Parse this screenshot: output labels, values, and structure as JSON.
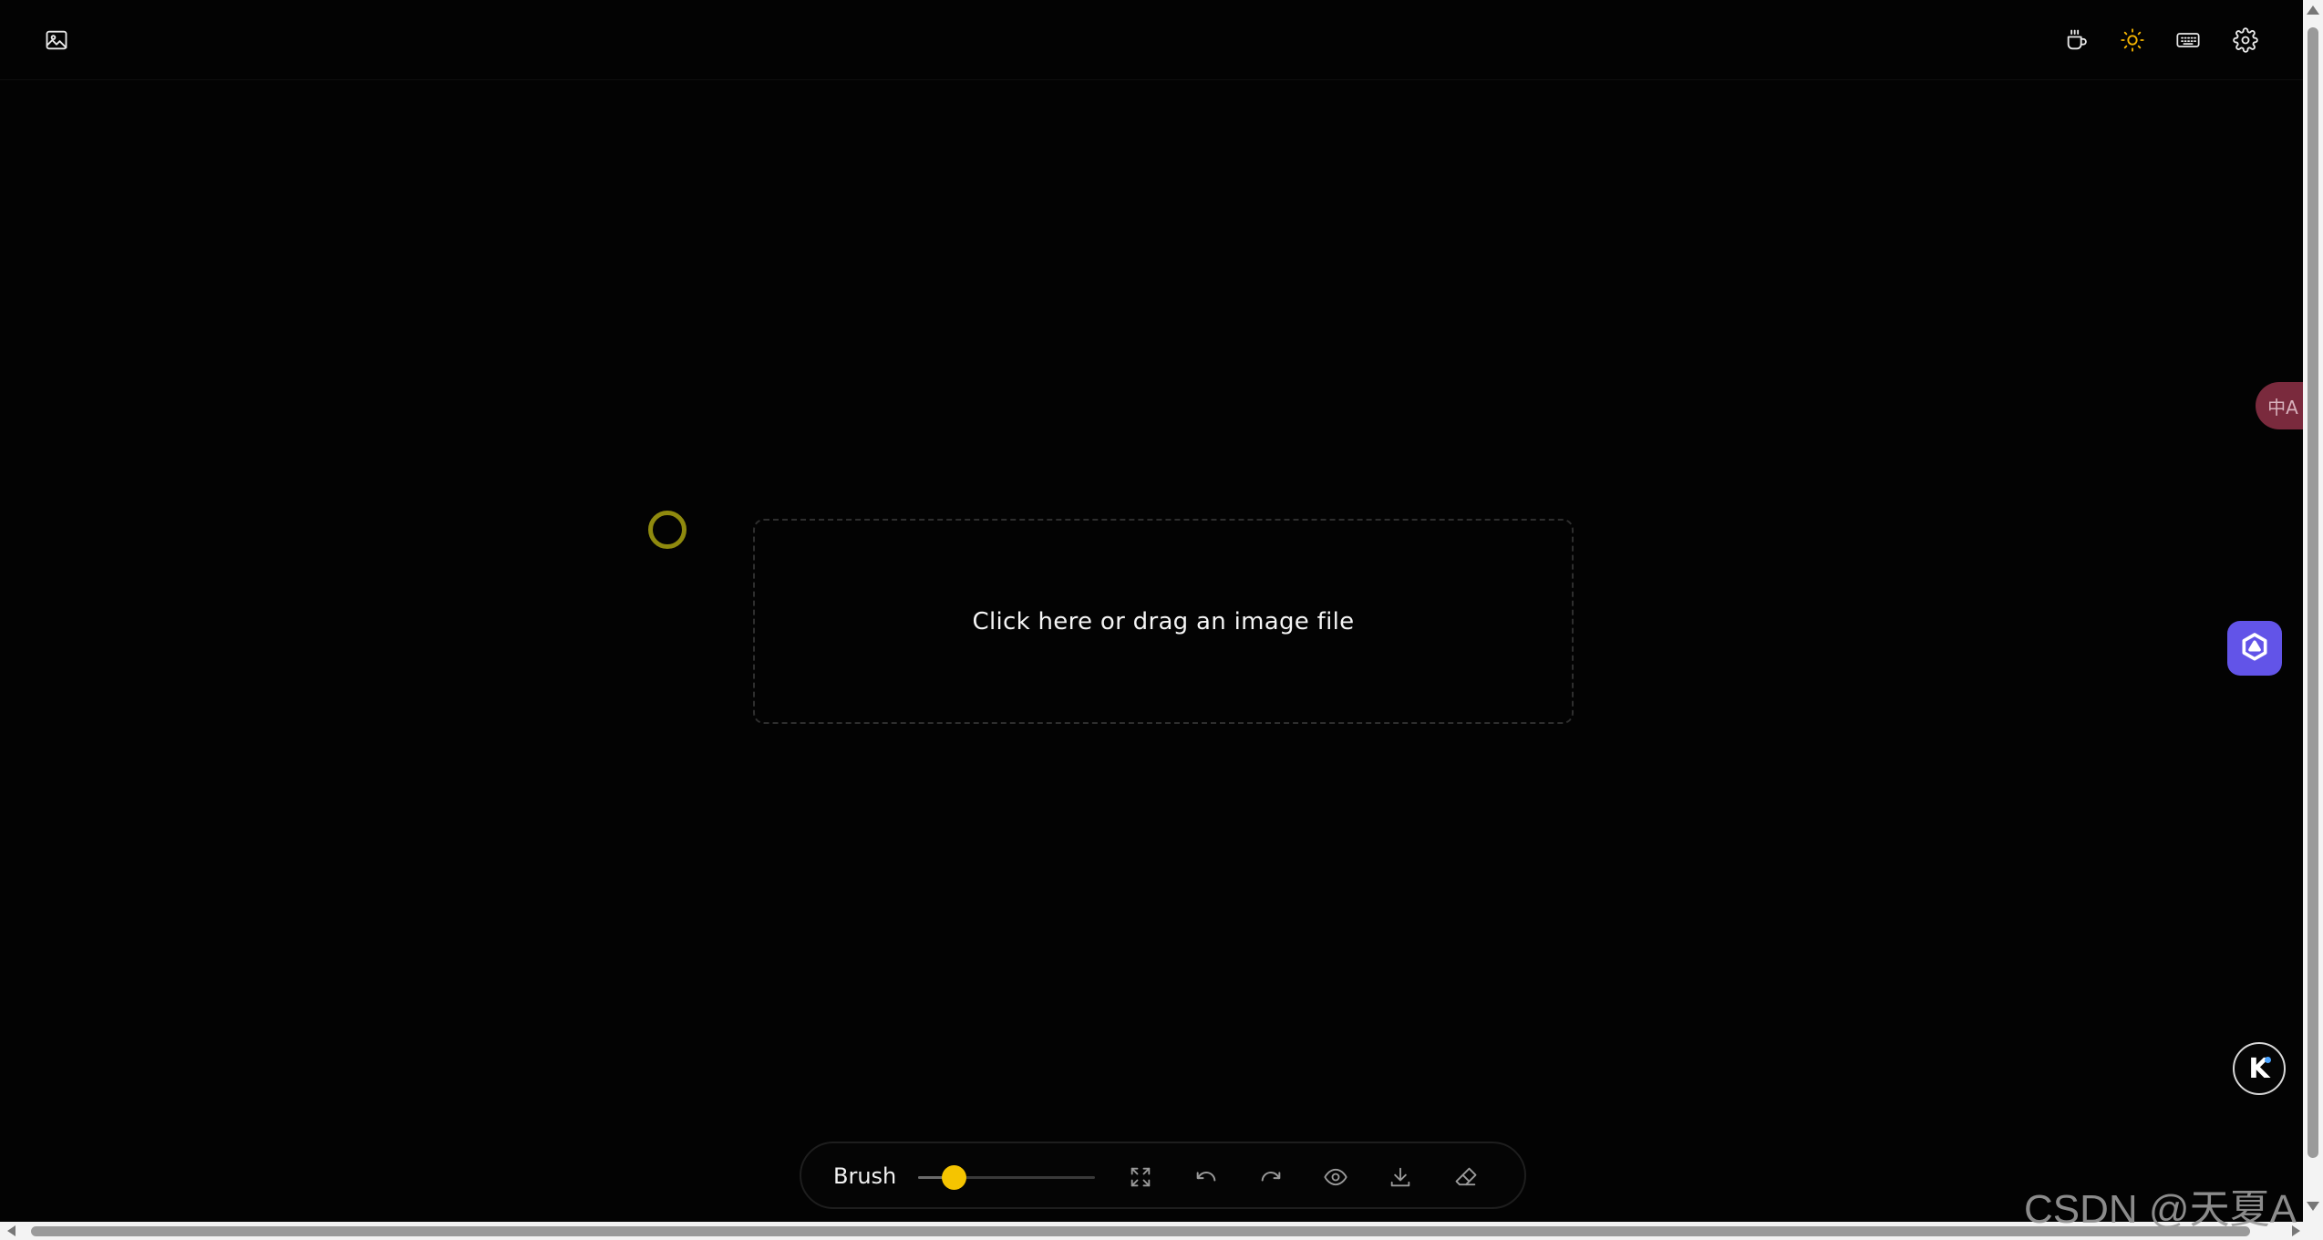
{
  "header": {
    "open_image_icon": "image-icon",
    "coffee_icon": "coffee-icon",
    "theme_icon": "sun-icon",
    "keyboard_icon": "keyboard-icon",
    "settings_icon": "gear-icon",
    "theme_icon_color": "#f5b400"
  },
  "canvas": {
    "dropzone_text": "Click here or drag an image file",
    "brush_cursor_color": "#8f8a0e"
  },
  "toolbar": {
    "brush_label": "Brush",
    "brush_size_fraction": 0.2,
    "slider_thumb_color": "#f5c400",
    "icons": [
      "expand-icon",
      "undo-icon",
      "redo-icon",
      "eye-icon",
      "download-icon",
      "eraser-icon"
    ]
  },
  "widgets": {
    "translate_label": "中A",
    "translate_color": "#7a2a3d",
    "ai_color": "#6254e8",
    "k_label": "K"
  },
  "watermark": "CSDN @天夏Ai"
}
